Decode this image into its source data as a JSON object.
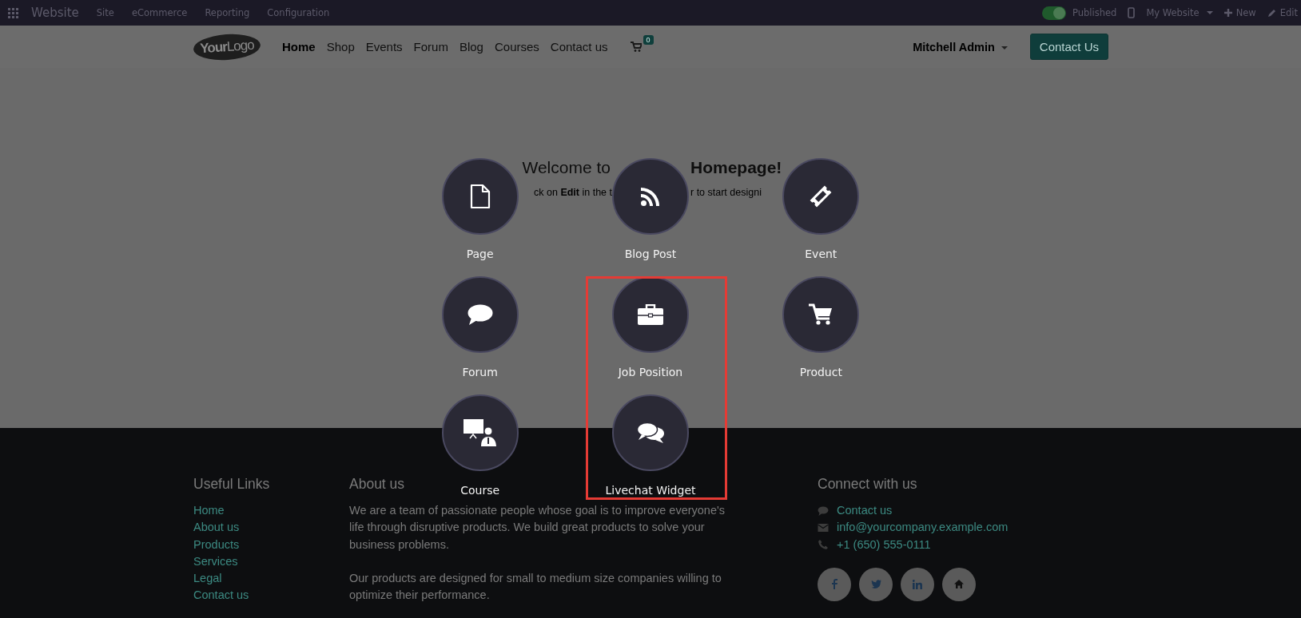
{
  "top_bar": {
    "app_name": "Website",
    "menu": [
      "Site",
      "eCommerce",
      "Reporting",
      "Configuration"
    ],
    "published": {
      "label": "Published",
      "on": true
    },
    "website_switcher": "My Website",
    "new_button": "New",
    "edit_button": "Edit"
  },
  "nav": {
    "logo": "**Your**Logo",
    "links": [
      {
        "label": "Home",
        "selected": true
      },
      {
        "label": "Shop",
        "selected": false
      },
      {
        "label": "Events",
        "selected": false
      },
      {
        "label": "Forum",
        "selected": false
      },
      {
        "label": "Blog",
        "selected": false
      },
      {
        "label": "Courses",
        "selected": false
      },
      {
        "label": "Contact us",
        "selected": false
      }
    ],
    "cart_count": "0",
    "user": "Mitchell Admin",
    "cta": "Contact Us"
  },
  "hero": {
    "title_left": "Welcome to",
    "title_right": "Homepage!",
    "subtitle_left": "ck on **Edit** in the t",
    "subtitle_right": "r to start designi"
  },
  "new_content": {
    "items": [
      {
        "label": "Page",
        "kind": "page"
      },
      {
        "label": "Blog Post",
        "kind": "blog"
      },
      {
        "label": "Event",
        "kind": "event"
      },
      {
        "label": "Forum",
        "kind": "forum"
      },
      {
        "label": "Job Position",
        "kind": "job"
      },
      {
        "label": "Product",
        "kind": "product"
      },
      {
        "label": "Course",
        "kind": "course"
      },
      {
        "label": "Livechat Widget",
        "kind": "livechat"
      }
    ]
  },
  "footer": {
    "useful_links": {
      "title": "Useful Links",
      "links": [
        "Home",
        "About us",
        "Products",
        "Services",
        "Legal",
        "Contact us"
      ]
    },
    "about": {
      "title": "About us",
      "paragraphs": [
        "We are a team of passionate people whose goal is to improve everyone's life through disruptive products. We build great products to solve your business problems.",
        "Our products are designed for small to medium size companies willing to optimize their performance."
      ]
    },
    "connect": {
      "title": "Connect with us",
      "contacts": [
        {
          "kind": "chat",
          "text": "Contact us"
        },
        {
          "kind": "email",
          "text": "info@yourcompany.example.com"
        },
        {
          "kind": "phone",
          "text": "+1 (650) 555-0111"
        }
      ],
      "social": [
        {
          "kind": "facebook"
        },
        {
          "kind": "twitter"
        },
        {
          "kind": "linkedin"
        },
        {
          "kind": "home"
        }
      ]
    }
  }
}
